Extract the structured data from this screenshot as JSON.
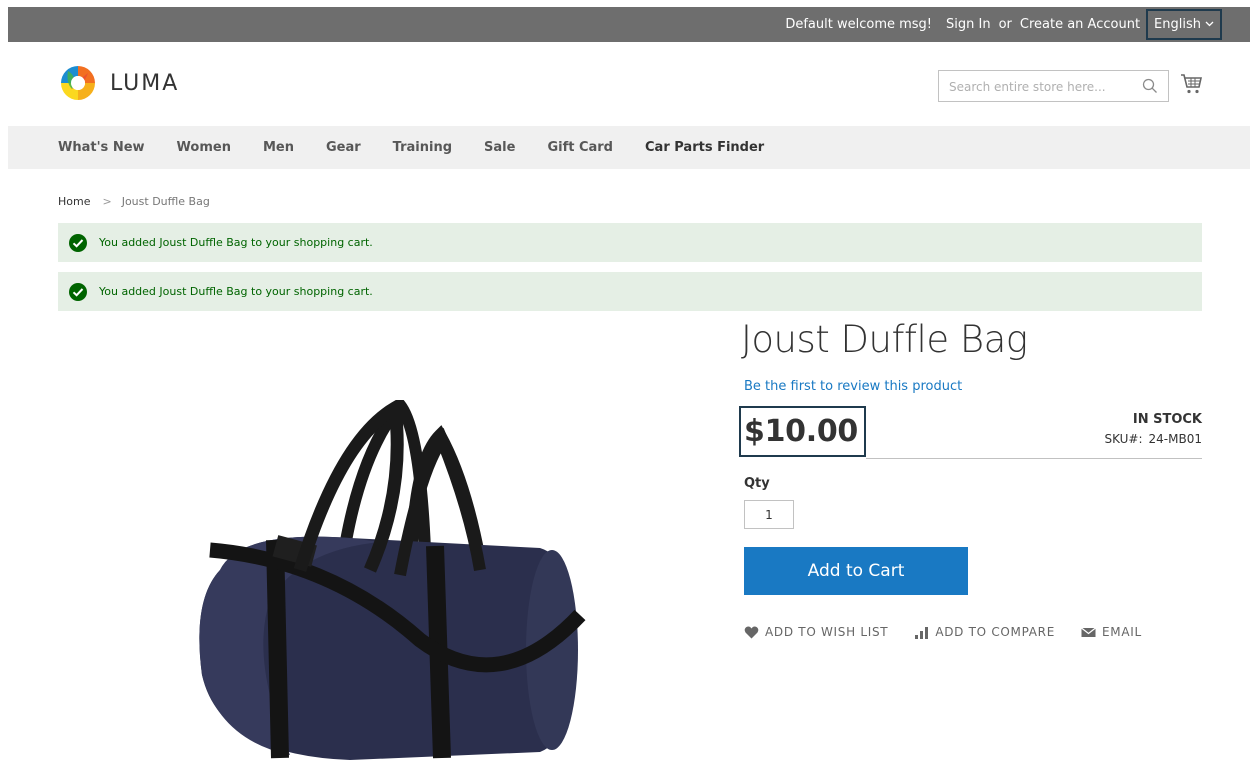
{
  "topbar": {
    "welcome": "Default welcome msg!",
    "sign_in": "Sign In",
    "or": "or",
    "create_account": "Create an Account",
    "language": "English"
  },
  "header": {
    "logo_text": "LUMA",
    "search_placeholder": "Search entire store here..."
  },
  "nav": {
    "items": [
      "What's New",
      "Women",
      "Men",
      "Gear",
      "Training",
      "Sale",
      "Gift Card",
      "Car Parts Finder"
    ]
  },
  "breadcrumbs": {
    "home": "Home",
    "separator": ">",
    "current": "Joust Duffle Bag"
  },
  "messages": [
    "You added Joust Duffle Bag to your shopping cart.",
    "You added Joust Duffle Bag to your shopping cart."
  ],
  "product": {
    "title": "Joust Duffle Bag",
    "review_link": "Be the first to review this product",
    "price": "$10.00",
    "stock": "IN STOCK",
    "sku_label": "SKU#:",
    "sku": "24-MB01",
    "qty_label": "Qty",
    "qty_value": "1",
    "add_to_cart": "Add to Cart",
    "add_to_wishlist": "ADD TO WISH LIST",
    "add_to_compare": "ADD TO COMPARE",
    "email": "EMAIL"
  },
  "colors": {
    "topbar_bg": "#6e6e6e",
    "nav_bg": "#f0f0f0",
    "accent": "#1979c3",
    "success_bg": "#e5efe5",
    "success_text": "#006400",
    "focus_border": "#1f3a4d"
  }
}
